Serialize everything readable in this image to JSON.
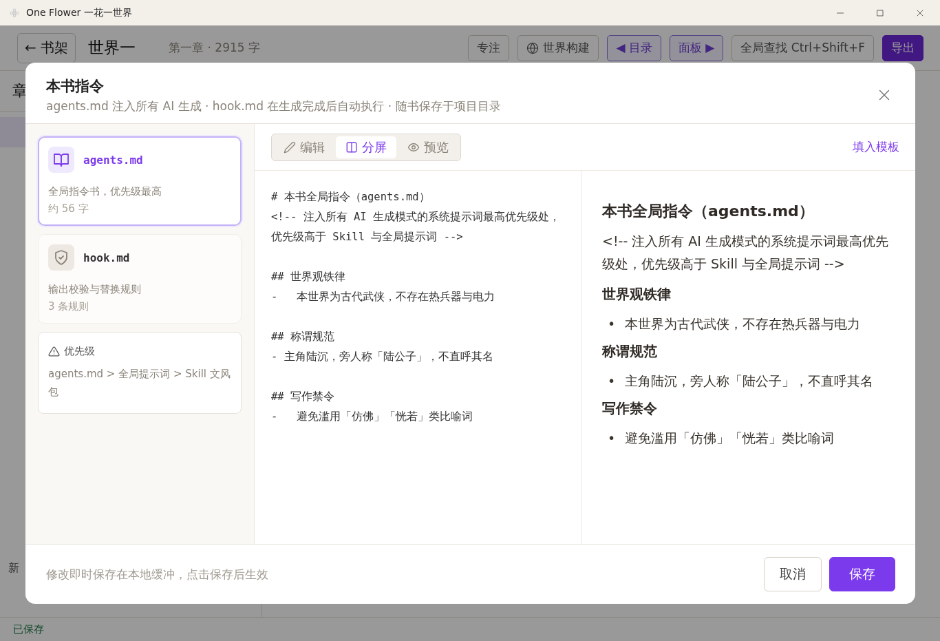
{
  "window": {
    "title": "One Flower 一花一世界"
  },
  "app": {
    "back_button": "← 书架",
    "book_title": "世界一",
    "chapter_info": "第一章 · 2915 字",
    "toolbar": [
      {
        "label": "专注",
        "kind": "plain"
      },
      {
        "label": "世界构建",
        "kind": "globe"
      },
      {
        "label": "◀ 目录",
        "kind": "accent"
      },
      {
        "label": "面板 ▶",
        "kind": "accent"
      },
      {
        "label": "全局查找 Ctrl+Shift+F",
        "kind": "plain"
      },
      {
        "label": "导出",
        "kind": "primary"
      }
    ],
    "sidebar_heading": "章",
    "new_label": "新",
    "status": "已保存"
  },
  "dialog": {
    "title": "本书指令",
    "subtitle": "agents.md 注入所有 AI 生成 · hook.md 在生成完成后自动执行 · 随书保存于项目目录",
    "files": [
      {
        "name": "agents.md",
        "description": "全局指令书，优先级最高",
        "meta": "约 56 字",
        "kind": "instructions",
        "selected": true
      },
      {
        "name": "hook.md",
        "description": "输出校验与替换规则",
        "meta": "3 条规则",
        "kind": "hook",
        "selected": false
      }
    ],
    "priority_note": {
      "title": "优先级",
      "text": "agents.md > 全局提示词 > Skill 文风包"
    },
    "view_tabs": [
      {
        "label": "编辑",
        "kind": "edit",
        "selected": false
      },
      {
        "label": "分屏",
        "kind": "split",
        "selected": true
      },
      {
        "label": "预览",
        "kind": "preview",
        "selected": false
      }
    ],
    "fill_template_link": "填入模板",
    "editor_blocks": [
      [
        "# 本书全局指令（agents.md）",
        "<!-- 注入所有 AI 生成模式的系统提示词最高优先级处，优先级高于 Skill 与全局提示词 -->"
      ],
      [
        "## 世界观铁律",
        "-   本世界为古代武侠，不存在热兵器与电力"
      ],
      [
        "## 称谓规范",
        "- 主角陆沉，旁人称「陆公子」，不直呼其名"
      ],
      [
        "## 写作禁令",
        "-   避免滥用「仿佛」「恍若」类比喻词"
      ]
    ],
    "preview": [
      {
        "kind": "h1",
        "text": "本书全局指令（agents.md）"
      },
      {
        "kind": "p",
        "text": "<!-- 注入所有 AI 生成模式的系统提示词最高优先级处，优先级高于 Skill 与全局提示词 -->"
      },
      {
        "kind": "h2",
        "text": "世界观铁律"
      },
      {
        "kind": "li",
        "marker": "•",
        "text": "本世界为古代武侠，不存在热兵器与电力"
      },
      {
        "kind": "h2",
        "text": "称谓规范"
      },
      {
        "kind": "li",
        "marker": "•",
        "text": "主角陆沉，旁人称「陆公子」，不直呼其名"
      },
      {
        "kind": "h2",
        "text": "写作禁令"
      },
      {
        "kind": "li",
        "marker": "•",
        "text": "避免滥用「仿佛」「恍若」类比喻词"
      }
    ],
    "footer_note": "修改即时保存在本地缓冲，点击保存后生效",
    "buttons": [
      {
        "label": "取消",
        "kind": "secondary"
      },
      {
        "label": "保存",
        "kind": "primary"
      }
    ]
  }
}
